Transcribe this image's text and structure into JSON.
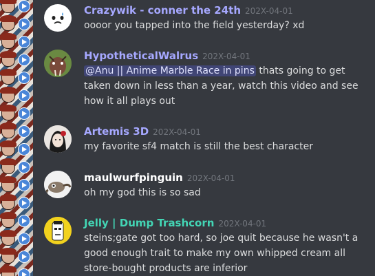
{
  "colors": {
    "background": "#36393f",
    "text": "#dcddde",
    "timestamp": "#72767d",
    "mention_bg": "#5865f2"
  },
  "messages": [
    {
      "username": "Crazywik - conner the 24th",
      "username_color": "#a6a8ff",
      "timestamp": "202X-04-01",
      "avatar_icon": "white-face-icon",
      "text": "oooor you tapped into the field yesterday? xd"
    },
    {
      "username": "HypotheticalWalrus",
      "username_color": "#a6a8ff",
      "timestamp": "202X-04-01",
      "avatar_icon": "walrus-avatar-icon",
      "mention": "@Anu || Anime Marble Race in pins",
      "text": " thats going to get taken down in less than a year, watch this video and see how it all plays out"
    },
    {
      "username": "Artemis 3D",
      "username_color": "#a6a8ff",
      "timestamp": "202X-04-01",
      "avatar_icon": "portrait-avatar-icon",
      "text": "my favorite sf4 match is still the best character"
    },
    {
      "username": "maulwurfpinguin",
      "username_color": "#ffffff",
      "timestamp": "202X-04-01",
      "avatar_icon": "creature-avatar-icon",
      "text": "oh my god this is so sad"
    },
    {
      "username": "Jelly | Dump Trashcorn",
      "username_color": "#43d6b5",
      "timestamp": "202X-04-01",
      "avatar_icon": "yellow-character-avatar-icon",
      "text": "steins;gate got too hard, so joe quit because he wasn't a good enough trait to make my own whipped cream all store-bought products are inferior"
    }
  ]
}
